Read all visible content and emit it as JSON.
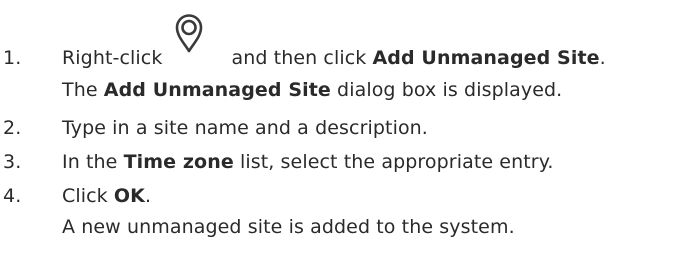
{
  "steps": [
    {
      "number": "1.",
      "part1": "Right-click",
      "icon": "location-pin-icon",
      "part2": "and then click ",
      "bold1": "Add Unmanaged Site",
      "part3": ".",
      "continuation": {
        "part1": "The ",
        "bold1": "Add Unmanaged Site",
        "part2": " dialog box is displayed."
      }
    },
    {
      "number": "2.",
      "text": "Type in a site name and a description."
    },
    {
      "number": "3.",
      "part1": "In the ",
      "bold1": "Time zone",
      "part2": " list, select the appropriate entry."
    },
    {
      "number": "4.",
      "part1": "Click ",
      "bold1": "OK",
      "part2": ".",
      "continuation": {
        "text": "A new unmanaged site is added to the system."
      }
    }
  ]
}
